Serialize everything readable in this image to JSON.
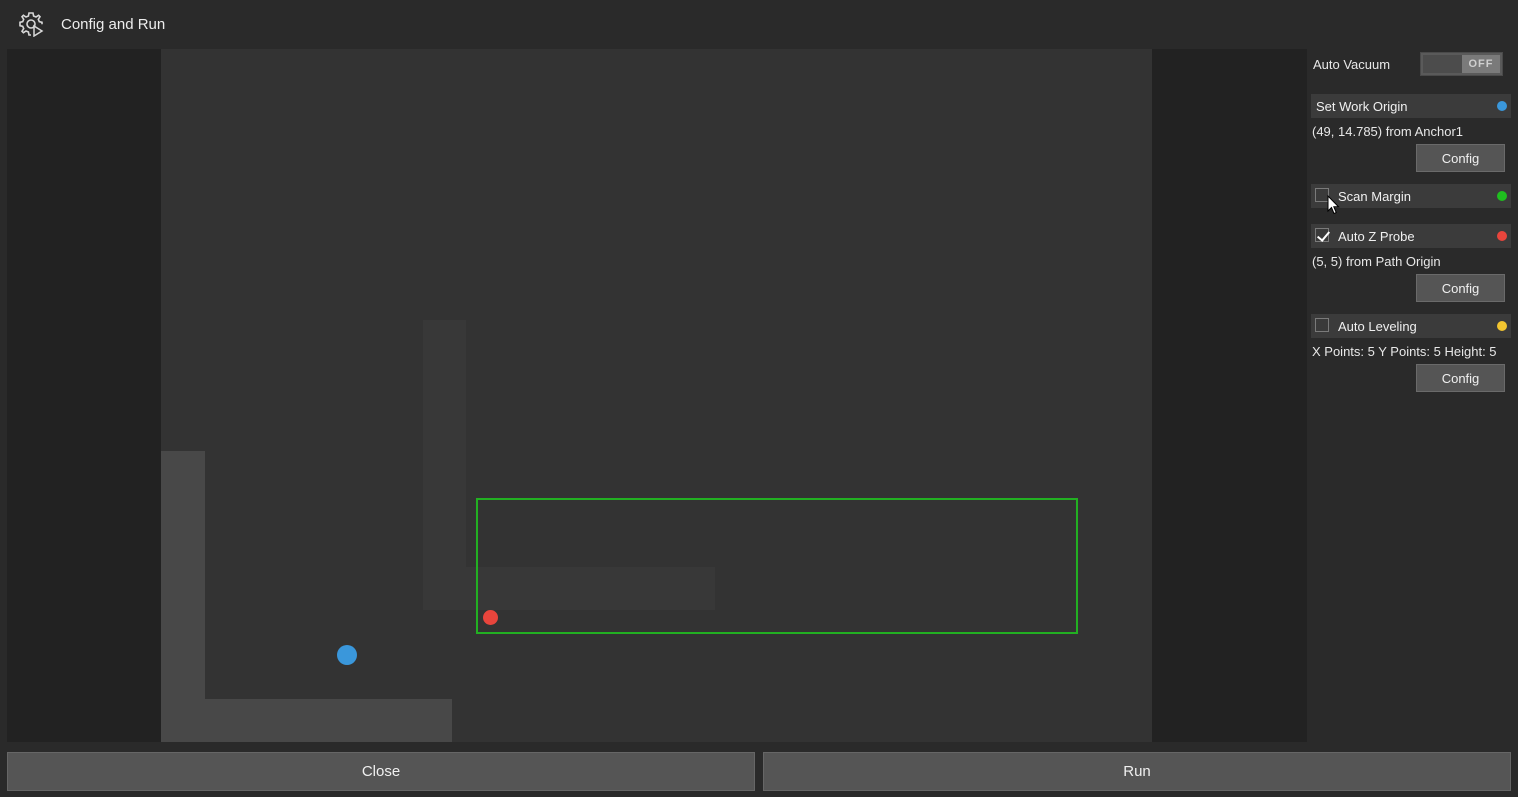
{
  "window": {
    "title": "Config and Run",
    "icon": "gear-play-icon"
  },
  "panel": {
    "auto_vacuum": {
      "label": "Auto Vacuum",
      "toggle_state": "OFF"
    },
    "set_work_origin": {
      "label": "Set Work Origin",
      "color": "#3a97db",
      "info": "(49, 14.785) from Anchor1",
      "config_label": "Config"
    },
    "scan_margin": {
      "label": "Scan Margin",
      "checked": false,
      "color": "#1fbf1f"
    },
    "auto_z_probe": {
      "label": "Auto Z Probe",
      "checked": true,
      "color": "#e8453c",
      "info": "(5, 5) from Path Origin",
      "config_label": "Config"
    },
    "auto_leveling": {
      "label": "Auto Leveling",
      "checked": false,
      "color": "#f2c530",
      "info": "X Points: 5 Y Points: 5 Height: 5",
      "config_label": "Config"
    }
  },
  "footer": {
    "close_label": "Close",
    "run_label": "Run"
  },
  "colors": {
    "background": "#2a2a2a",
    "board": "#333333",
    "scan_rect": "#22b022",
    "work_origin": "#3a97db",
    "z_probe": "#e8453c"
  }
}
